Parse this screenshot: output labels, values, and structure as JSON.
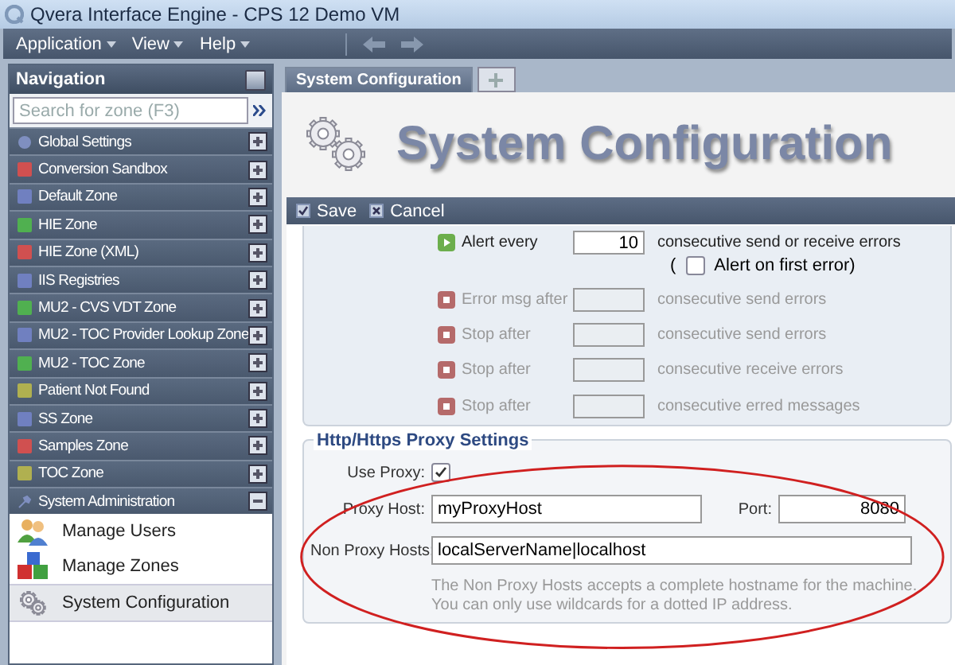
{
  "window": {
    "title": "Qvera Interface Engine - CPS 12 Demo VM"
  },
  "menu": [
    {
      "label": "Application"
    },
    {
      "label": "View"
    },
    {
      "label": "Help"
    }
  ],
  "navigation": {
    "title": "Navigation",
    "search": {
      "placeholder": "Search for zone (F3)"
    },
    "items": [
      {
        "label": "Global Settings",
        "kind": "settings",
        "color": "#7f8fc0",
        "expanded": false
      },
      {
        "label": "Conversion Sandbox",
        "kind": "zone",
        "color": "#d05050",
        "expanded": false
      },
      {
        "label": "Default Zone",
        "kind": "zone",
        "color": "#7080c0",
        "expanded": false
      },
      {
        "label": "HIE Zone",
        "kind": "zone",
        "color": "#50b050",
        "expanded": false
      },
      {
        "label": "HIE Zone (XML)",
        "kind": "zone",
        "color": "#d05050",
        "expanded": false
      },
      {
        "label": "IIS Registries",
        "kind": "zone",
        "color": "#7080c0",
        "expanded": false
      },
      {
        "label": "MU2 - CVS VDT Zone",
        "kind": "zone",
        "color": "#50b050",
        "expanded": false
      },
      {
        "label": "MU2 - TOC Provider Lookup Zone",
        "kind": "zone",
        "color": "#7080c0",
        "expanded": false
      },
      {
        "label": "MU2 - TOC Zone",
        "kind": "zone",
        "color": "#50b050",
        "expanded": false
      },
      {
        "label": "Patient Not Found",
        "kind": "zone",
        "color": "#b0b050",
        "expanded": false
      },
      {
        "label": "SS Zone",
        "kind": "zone",
        "color": "#7080c0",
        "expanded": false
      },
      {
        "label": "Samples Zone",
        "kind": "zone",
        "color": "#d05050",
        "expanded": false
      },
      {
        "label": "TOC Zone",
        "kind": "zone",
        "color": "#b0b050",
        "expanded": false
      },
      {
        "label": "System Administration",
        "kind": "admin",
        "color": "#7f8fc0",
        "expanded": true
      }
    ],
    "sub_items": [
      {
        "label": "Manage Users",
        "kind": "users",
        "selected": false
      },
      {
        "label": "Manage Zones",
        "kind": "zones",
        "selected": false
      },
      {
        "label": "System Configuration",
        "kind": "config",
        "selected": true
      }
    ]
  },
  "tabs": [
    {
      "label": "System Configuration",
      "selected": true
    }
  ],
  "page": {
    "title": "System Configuration"
  },
  "toolbar": [
    {
      "label": "Save",
      "kind": "save"
    },
    {
      "label": "Cancel",
      "kind": "cancel"
    }
  ],
  "alert_rows": [
    {
      "label": "Alert every",
      "value": "10",
      "suffix": "consecutive send or receive errors",
      "disabled": false
    },
    {
      "label": "Error msg after",
      "suffix": "consecutive send errors",
      "disabled": true
    },
    {
      "label": "Stop after",
      "suffix": "consecutive send errors",
      "disabled": true
    },
    {
      "label": "Stop after",
      "suffix": "consecutive receive errors",
      "disabled": true
    },
    {
      "label": "Stop after",
      "suffix": "consecutive erred messages",
      "disabled": true
    }
  ],
  "alert_first": {
    "prefix": "(",
    "label": "Alert on first error)",
    "checked": false
  },
  "proxy": {
    "legend": "Http/Https Proxy Settings",
    "use_proxy": {
      "label": "Use Proxy:",
      "checked": true
    },
    "host": {
      "label": "Proxy Host:",
      "value": "myProxyHost"
    },
    "port": {
      "label": "Port:",
      "value": "8080"
    },
    "non_proxy": {
      "label": "Non Proxy Hosts:",
      "value": "localServerName|localhost"
    },
    "note": "The Non Proxy Hosts accepts a complete hostname for the machine. You can only use wildcards for a dotted IP address."
  }
}
